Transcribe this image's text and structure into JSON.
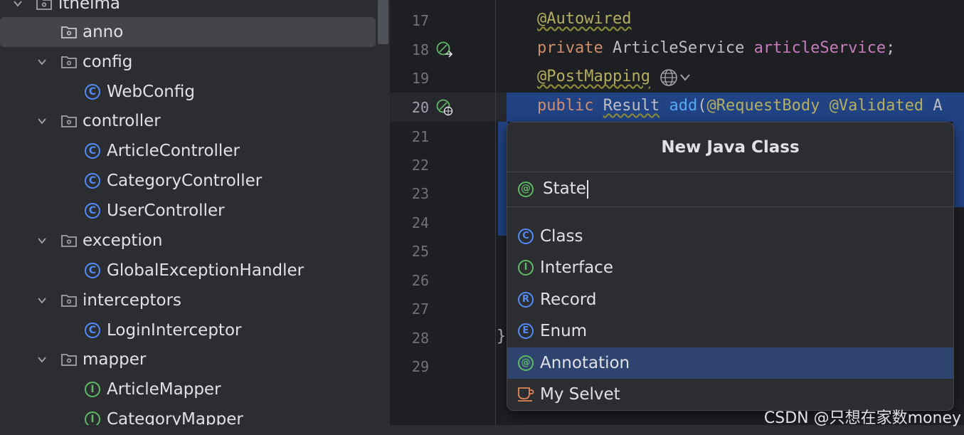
{
  "tree": {
    "items": [
      {
        "label": "itheima",
        "kind": "package",
        "expanded": true
      },
      {
        "label": "anno",
        "kind": "package",
        "selected": true
      },
      {
        "label": "config",
        "kind": "package",
        "expanded": true
      },
      {
        "label": "WebConfig",
        "kind": "class"
      },
      {
        "label": "controller",
        "kind": "package",
        "expanded": true
      },
      {
        "label": "ArticleController",
        "kind": "class"
      },
      {
        "label": "CategoryController",
        "kind": "class"
      },
      {
        "label": "UserController",
        "kind": "class"
      },
      {
        "label": "exception",
        "kind": "package",
        "expanded": true
      },
      {
        "label": "GlobalExceptionHandler",
        "kind": "class"
      },
      {
        "label": "interceptors",
        "kind": "package",
        "expanded": true
      },
      {
        "label": "LoginInterceptor",
        "kind": "class"
      },
      {
        "label": "mapper",
        "kind": "package",
        "expanded": true
      },
      {
        "label": "ArticleMapper",
        "kind": "interface"
      },
      {
        "label": "CategoryMapper",
        "kind": "interface"
      }
    ],
    "class_letter": "C",
    "interface_letter": "I"
  },
  "editor": {
    "line_numbers": [
      "17",
      "18",
      "19",
      "20",
      "21",
      "22",
      "23",
      "24",
      "25",
      "26",
      "27",
      "28",
      "29"
    ],
    "current_line": "20",
    "code": {
      "l17_anno": "@Autowired",
      "l18_kw": "private",
      "l18_type": " ArticleService ",
      "l18_field": "articleService",
      "l18_end": ";",
      "l19_anno": "@PostMapping",
      "l20_kw": "public",
      "l20_sp": " ",
      "l20_type": "Result",
      "l20_sp2": " ",
      "l20_fn": "add",
      "l20_paren": "(",
      "l20_anno1": "@RequestBody",
      "l20_sp3": " ",
      "l20_anno2": "@Validated",
      "l20_rest": " A",
      "l28_brace": "}"
    }
  },
  "popup": {
    "title": "New Java Class",
    "input_value": "State",
    "input_icon": "@",
    "options": [
      {
        "label": "Class",
        "icon_letter": "C",
        "icon_color": "#548af7"
      },
      {
        "label": "Interface",
        "icon_letter": "I",
        "icon_color": "#5fb865"
      },
      {
        "label": "Record",
        "icon_letter": "R",
        "icon_color": "#548af7"
      },
      {
        "label": "Enum",
        "icon_letter": "E",
        "icon_color": "#548af7"
      },
      {
        "label": "Annotation",
        "icon_letter": "@",
        "icon_color": "#5fb865",
        "selected": true
      },
      {
        "label": "My Selvet",
        "icon_letter": "",
        "icon_color": "#e08855"
      }
    ]
  },
  "watermark": "CSDN @只想在家数money",
  "colors": {
    "accent_blue": "#548af7",
    "interface_green": "#5fb865",
    "selection": "#214283",
    "popup_selected": "#2e436e"
  }
}
